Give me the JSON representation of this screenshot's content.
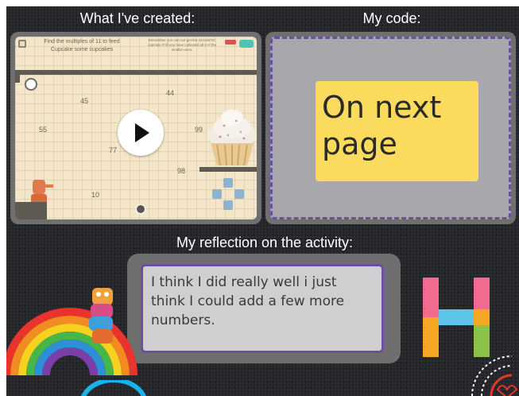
{
  "headings": {
    "created": "What I've created:",
    "code": "My code:",
    "reflection": "My reflection on the activity:"
  },
  "game": {
    "instruction": "Find the multiples of 11 to feed Cupcake some cupcakes",
    "note": "Remember you can not get the GIGANTIC cupcake if till you have collected all 6 of the smaller ones.",
    "numbers": [
      "44",
      "45",
      "55",
      "99",
      "77",
      "98",
      "10"
    ]
  },
  "code_note": "On next page",
  "reflection_text": "I think I did really well i just think I could add a few more numbers.",
  "colors": {
    "board": "#25262a",
    "sticky": "#fbdb5d",
    "purple_border": "#6a4fa3",
    "frame_grey": "#6f6f6f"
  },
  "icons": [
    "play-icon",
    "dpad-icon",
    "cupcake-icon",
    "rainbow-sticker",
    "h-logo",
    "robot-character"
  ]
}
